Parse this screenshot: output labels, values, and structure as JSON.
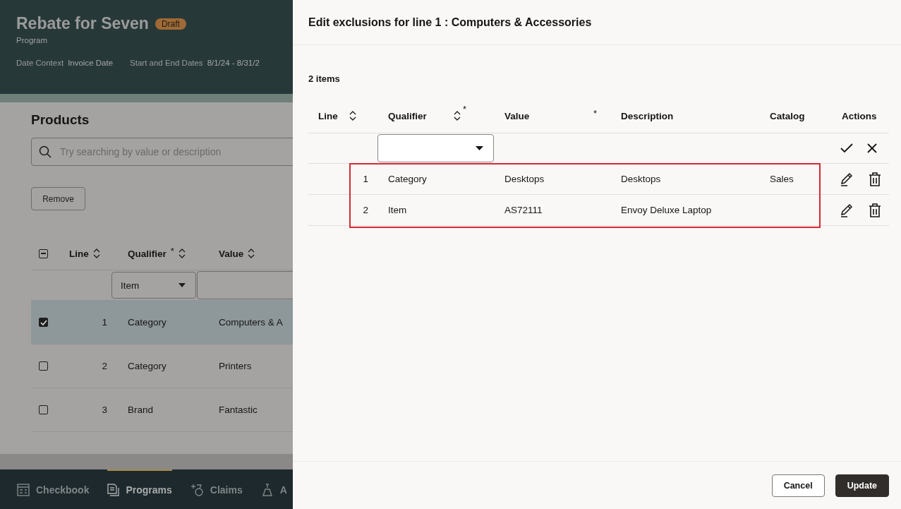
{
  "page": {
    "title": "Rebate for Seven",
    "badge": "Draft",
    "subtitle": "Program",
    "meta": [
      {
        "label": "Date Context",
        "value": "Invoice Date"
      },
      {
        "label": "Start and End Dates",
        "value": "8/1/24 - 8/31/2"
      }
    ]
  },
  "products": {
    "title": "Products",
    "search": {
      "placeholder": "Try searching by value or description"
    },
    "remove_button": "Remove",
    "select_all_indeterminate": true,
    "columns": [
      {
        "label": "Line",
        "sortable": true
      },
      {
        "label": "Qualifier",
        "sortable": true,
        "required_mark": "*"
      },
      {
        "label": "Value",
        "sortable": true
      }
    ],
    "filter": {
      "qualifier": "Item"
    },
    "rows": [
      {
        "line": "1",
        "qualifier": "Category",
        "value": "Computers & A",
        "selected": true
      },
      {
        "line": "2",
        "qualifier": "Category",
        "value": "Printers",
        "selected": false
      },
      {
        "line": "3",
        "qualifier": "Brand",
        "value": "Fantastic",
        "selected": false
      }
    ]
  },
  "nav": [
    {
      "label": "Checkbook",
      "selected": false,
      "kind": "checkbook"
    },
    {
      "label": "Programs",
      "selected": true,
      "kind": "programs"
    },
    {
      "label": "Claims",
      "selected": false,
      "kind": "claims"
    },
    {
      "label": "A",
      "selected": false,
      "kind": "other"
    }
  ],
  "drawer": {
    "title": "Edit exclusions for line 1 : Computers & Accessories",
    "count": "2 items",
    "columns": [
      {
        "label": "Line",
        "sortable": true
      },
      {
        "label": "Qualifier",
        "sortable": true,
        "required_mark": "*"
      },
      {
        "label": "Value",
        "sortable": false,
        "required_mark": "*"
      },
      {
        "label": "Description",
        "sortable": false
      },
      {
        "label": "Catalog",
        "sortable": false
      },
      {
        "label": "Actions",
        "sortable": false
      }
    ],
    "rows": [
      {
        "line": "1",
        "qualifier": "Category",
        "value": "Desktops",
        "description": "Desktops",
        "catalog": "Sales"
      },
      {
        "line": "2",
        "qualifier": "Item",
        "value": "AS72111",
        "description": "Envoy Deluxe Laptop"
      }
    ],
    "buttons": [
      {
        "label": "Cancel",
        "kind": "secondary"
      },
      {
        "label": "Update",
        "kind": "primary"
      }
    ]
  }
}
